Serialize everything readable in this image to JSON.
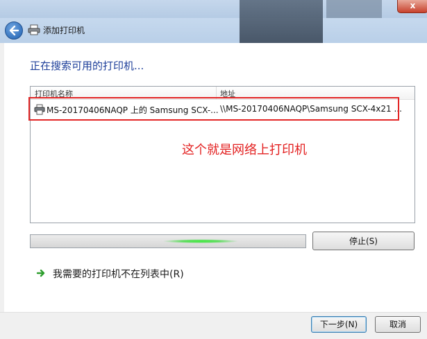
{
  "window": {
    "title": "添加打印机",
    "close_label": "x"
  },
  "main": {
    "heading": "正在搜索可用的打印机...",
    "columns": [
      "打印机名称",
      "地址"
    ],
    "rows": [
      {
        "name": "MS-20170406NAQP 上的 Samsung SCX-...",
        "address": "\\\\MS-20170406NAQP\\Samsung SCX-4x21 ..."
      }
    ],
    "annotation": "这个就是网络上打印机",
    "stop_label": "停止(S)",
    "not_listed_label": "我需要的打印机不在列表中(R)"
  },
  "footer": {
    "next_label": "下一步(N)",
    "cancel_label": "取消"
  },
  "icons": [
    "back-arrow-icon",
    "printer-icon",
    "green-arrow-icon"
  ],
  "colors": {
    "heading": "#1e3f9a",
    "annotation": "#e32020",
    "highlight_border": "#e32626",
    "progress_glow": "#3cf03c"
  }
}
